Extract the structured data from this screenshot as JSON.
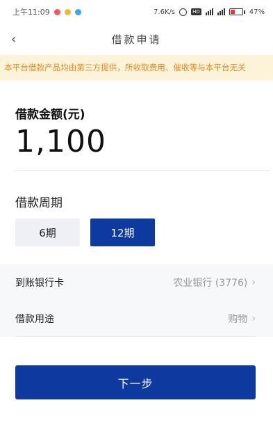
{
  "status_bar": {
    "time": "上午11:09",
    "speed": "7.6K/s",
    "battery": "47%"
  },
  "navbar": {
    "back_icon": "chevron-left-icon",
    "title": "借款申请"
  },
  "notice": {
    "text": "本平台借款产品均由第三方提供，所收取费用、催收等与本平台无关"
  },
  "loan": {
    "amount_label": "借款金额(元)",
    "amount_value": "1,100"
  },
  "period": {
    "label": "借款周期",
    "options": [
      "6期",
      "12期"
    ],
    "selected": "12期"
  },
  "rows": [
    {
      "label": "到账银行卡",
      "value": "农业银行 (3776)"
    },
    {
      "label": "借款用途",
      "value": "购物"
    }
  ],
  "next_button": {
    "label": "下一步"
  },
  "colors": {
    "primary": "#0e3a9f",
    "notice_bg": "#fdf3d9",
    "notice_text": "#e48a24"
  }
}
